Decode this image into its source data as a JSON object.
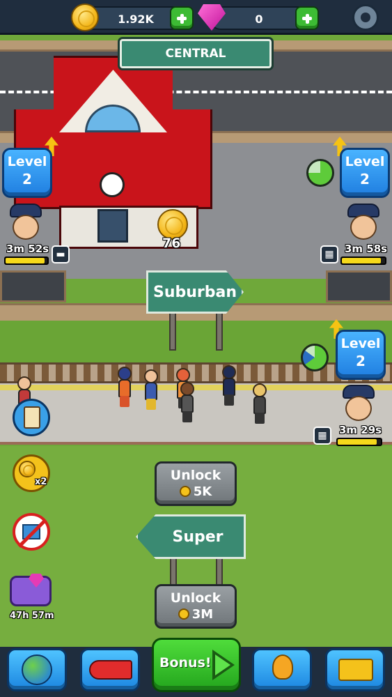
{
  "currency": {
    "coins": "1.92K",
    "gems": "0"
  },
  "signs": {
    "central": "CENTRAL",
    "suburban": "Suburban",
    "super_mall": "Super Mall"
  },
  "station": {
    "coin_count": "76"
  },
  "levels": {
    "station_left": {
      "label": "Level",
      "value": "2"
    },
    "station_right": {
      "label": "Level",
      "value": "2"
    },
    "suburban_right": {
      "label": "Level",
      "value": "2"
    }
  },
  "timers": {
    "left": {
      "text": "3m 52s",
      "progress": 0.93
    },
    "right": {
      "text": "3m 58s",
      "progress": 0.9
    },
    "platform": {
      "text": "3m 29s",
      "progress": 0.9
    }
  },
  "unlock": {
    "first": {
      "label": "Unlock",
      "cost": "5K"
    },
    "second": {
      "label": "Unlock",
      "cost": "3M"
    }
  },
  "side_tools": {
    "multiplier": "x2",
    "gem_timer": "47h 57m"
  },
  "nav": {
    "bonus_label": "Bonus!"
  },
  "colors": {
    "accent_green": "#3dbb34",
    "level_blue": "#2a8ef0",
    "sign_green": "#3a8a72",
    "timer_yellow": "#f6d91b"
  }
}
